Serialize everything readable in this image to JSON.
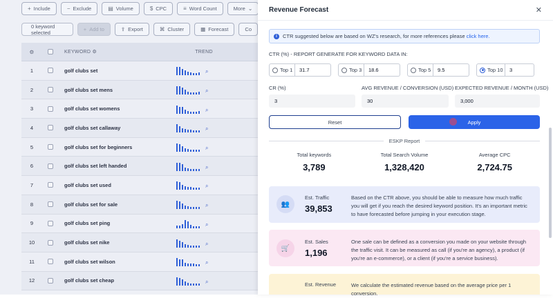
{
  "toolbar": {
    "filters": [
      {
        "label": "Include",
        "icon": "plus-icon"
      },
      {
        "label": "Exclude",
        "icon": "minus-icon"
      },
      {
        "label": "Volume",
        "icon": "volume-icon"
      },
      {
        "label": "CPC",
        "icon": "cpc-icon"
      },
      {
        "label": "Word Count",
        "icon": "word-count-icon"
      },
      {
        "label": "More",
        "icon": "chevron-down-icon"
      }
    ],
    "selected_count": "0 keyword selected",
    "actions": [
      {
        "label": "Add to",
        "icon": "plus-icon",
        "disabled": true
      },
      {
        "label": "Export",
        "icon": "export-icon",
        "disabled": false
      },
      {
        "label": "Cluster",
        "icon": "cluster-icon",
        "disabled": false
      },
      {
        "label": "Forecast",
        "icon": "forecast-icon",
        "disabled": false
      },
      {
        "label": "Co",
        "icon": "",
        "disabled": false
      }
    ]
  },
  "table": {
    "columns": {
      "keyword": "KEYWORD",
      "trend": "TREND"
    },
    "rows": [
      {
        "num": "1",
        "keyword": "golf clubs set"
      },
      {
        "num": "2",
        "keyword": "golf clubs set mens"
      },
      {
        "num": "3",
        "keyword": "golf clubs set womens"
      },
      {
        "num": "4",
        "keyword": "golf clubs set callaway"
      },
      {
        "num": "5",
        "keyword": "golf clubs set for beginners"
      },
      {
        "num": "6",
        "keyword": "golf clubs set left handed"
      },
      {
        "num": "7",
        "keyword": "golf clubs set used"
      },
      {
        "num": "8",
        "keyword": "golf clubs set for sale"
      },
      {
        "num": "9",
        "keyword": "golf clubs set ping"
      },
      {
        "num": "10",
        "keyword": "golf clubs set nike"
      },
      {
        "num": "11",
        "keyword": "golf clubs set wilson"
      },
      {
        "num": "12",
        "keyword": "golf clubs set cheap"
      }
    ]
  },
  "drawer": {
    "title": "Revenue Forecast",
    "info_text": "CTR suggested below are based on WZ's research, for more references please",
    "info_link": "click here.",
    "ctr_heading": "CTR (%) - REPORT GENERATE FOR KEYWORD DATA IN:",
    "tops": [
      {
        "label": "Top 1",
        "value": "31.7",
        "selected": false
      },
      {
        "label": "Top 3",
        "value": "18.6",
        "selected": false
      },
      {
        "label": "Top 5",
        "value": "9.5",
        "selected": false
      },
      {
        "label": "Top 10",
        "value": "3",
        "selected": true
      }
    ],
    "cr_label": "CR (%)",
    "cr_value": "3",
    "avg_rev_label": "AVG REVENUE / CONVERSION (USD)",
    "avg_rev_value": "30",
    "exp_rev_label": "EXPECTED REVENUE / MONTH (USD)",
    "exp_rev_value": "3,000",
    "reset_label": "Reset",
    "apply_label": "Apply",
    "report_title": "ESKP Report",
    "stats": [
      {
        "label": "Total keywords",
        "value": "3,789"
      },
      {
        "label": "Total Search Volume",
        "value": "1,328,420"
      },
      {
        "label": "Average CPC",
        "value": "2,724.75"
      }
    ],
    "cards": [
      {
        "label": "Est. Traffic",
        "value": "39,853",
        "icon": "users-icon",
        "desc": "Based on the CTR above, you should be able to measure how much traffic you will get if you reach the desired keyword position. It's an important metric to have forecasted before jumping in your execution stage."
      },
      {
        "label": "Est. Sales",
        "value": "1,196",
        "icon": "cart-icon",
        "desc": "One sale can be defined as a conversion you made on your website through the traffic visit. It can be measured as call (if you're an agency), a product (if you're an e-commerce), or a client (if you're a service business)."
      },
      {
        "label": "Est. Revenue",
        "value": "",
        "icon": "revenue-icon",
        "desc": "We calculate the estimated revenue based on the average price per 1 conversion."
      }
    ]
  },
  "colors": {
    "accent": "#2b63e8",
    "traffic_card": "#e8ecfb",
    "sales_card": "#fbe8f3",
    "revenue_card": "#fdf3d6"
  }
}
